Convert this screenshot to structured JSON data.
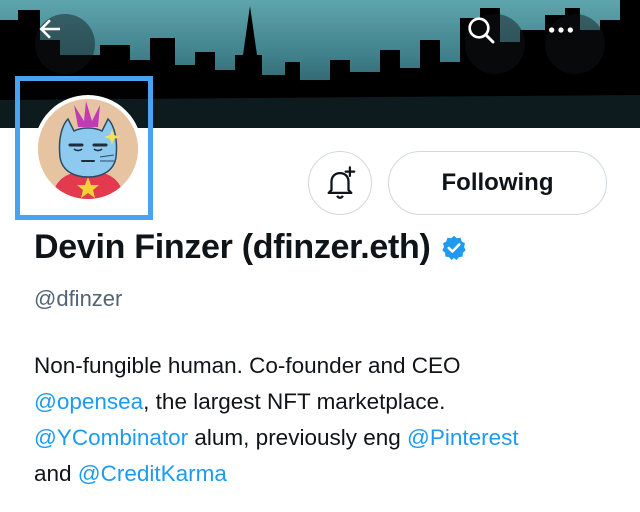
{
  "header": {
    "back_icon": "arrow-left-icon",
    "search_icon": "search-icon",
    "more_icon": "more-horizontal-icon",
    "banner": "city-skyline-banner"
  },
  "profile": {
    "display_name": "Devin Finzer (dfinzer.eth)",
    "handle": "@dfinzer",
    "verified": true,
    "accent_color": "#1d9bf0",
    "avatar": "cartoon-cat-avatar"
  },
  "actions": {
    "notify_icon": "bell-plus-icon",
    "following_label": "Following"
  },
  "bio": {
    "line1": "Non-fungible human. Co-founder and CEO",
    "mention_opensea": "@opensea",
    "line2_rest": ", the largest NFT marketplace.",
    "mention_ycombinator": "@YCombinator",
    "line3_mid": " alum, previously eng ",
    "mention_pinterest": "@Pinterest",
    "line4_start": "and ",
    "mention_creditkarma": "@CreditKarma"
  }
}
